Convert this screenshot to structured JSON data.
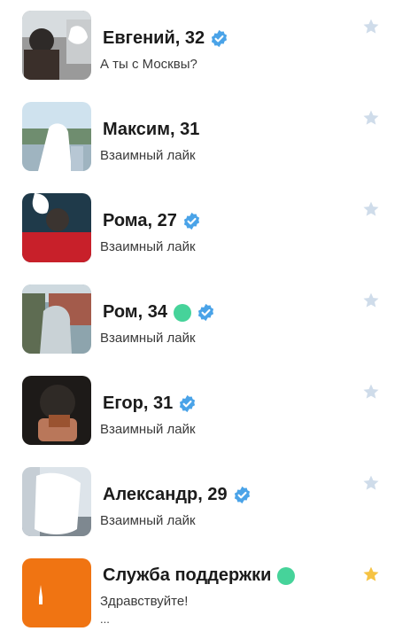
{
  "chats": [
    {
      "name": "Евгений",
      "age": "32",
      "preview": "А ты с Москвы?",
      "verified": true,
      "online": false,
      "favorite": false
    },
    {
      "name": "Максим",
      "age": "31",
      "preview": "Взаимный лайк",
      "verified": false,
      "online": false,
      "favorite": false
    },
    {
      "name": "Рома",
      "age": "27",
      "preview": "Взаимный лайк",
      "verified": true,
      "online": false,
      "favorite": false
    },
    {
      "name": "Ром",
      "age": "34",
      "preview": "Взаимный лайк",
      "verified": true,
      "online": true,
      "favorite": false
    },
    {
      "name": "Егор",
      "age": "31",
      "preview": "Взаимный лайк",
      "verified": true,
      "online": false,
      "favorite": false
    },
    {
      "name": "Александр",
      "age": "29",
      "preview": "Взаимный лайк",
      "verified": true,
      "online": false,
      "favorite": false
    },
    {
      "name": "Служба поддержки",
      "age": "",
      "preview": "Здравствуйте!",
      "preview_more": "...",
      "verified": false,
      "online": true,
      "favorite": true
    }
  ],
  "colors": {
    "verified": "#4aa3e8",
    "online": "#46d39a",
    "star_inactive": "#cfdcea",
    "star_active": "#f6c343",
    "support_avatar": "#f07412"
  }
}
